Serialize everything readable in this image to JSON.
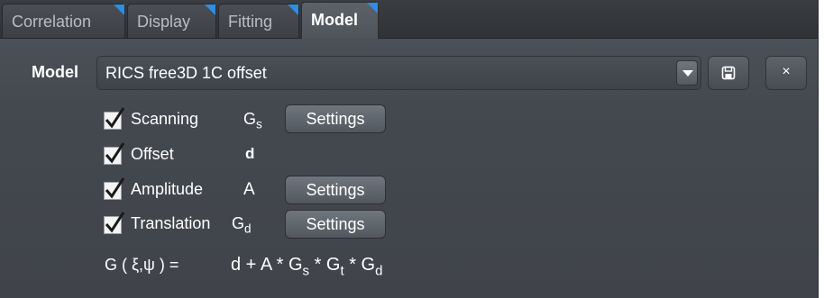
{
  "tabs": [
    "Correlation",
    "Display",
    "Fitting",
    "Model"
  ],
  "active_tab": "Model",
  "model": {
    "label": "Model",
    "selected": "RICS free3D 1C offset",
    "save_icon": "save-icon",
    "close_icon": "close-icon",
    "close_glyph": "×"
  },
  "components": [
    {
      "name": "Scanning",
      "checked": true,
      "symbol": "G",
      "symbol_sub": "s",
      "settings_label": "Settings"
    },
    {
      "name": "Offset",
      "checked": true,
      "symbol": "d",
      "symbol_sub": "",
      "settings_label": ""
    },
    {
      "name": "Amplitude",
      "checked": true,
      "symbol": "A",
      "symbol_sub": "",
      "settings_label": "Settings"
    },
    {
      "name": "Translation",
      "checked": true,
      "symbol": "G",
      "symbol_sub": "d",
      "settings_label": "Settings"
    }
  ],
  "formula": {
    "lhs": "G ( ξ,ψ ) =",
    "rhs": {
      "t1": "d + A * G",
      "s1": "s",
      "t2": " * G",
      "s2": "t",
      "t3": " * G",
      "s3": "d"
    }
  },
  "colors": {
    "accent": "#2f8de4",
    "panel": "#4b5058"
  }
}
